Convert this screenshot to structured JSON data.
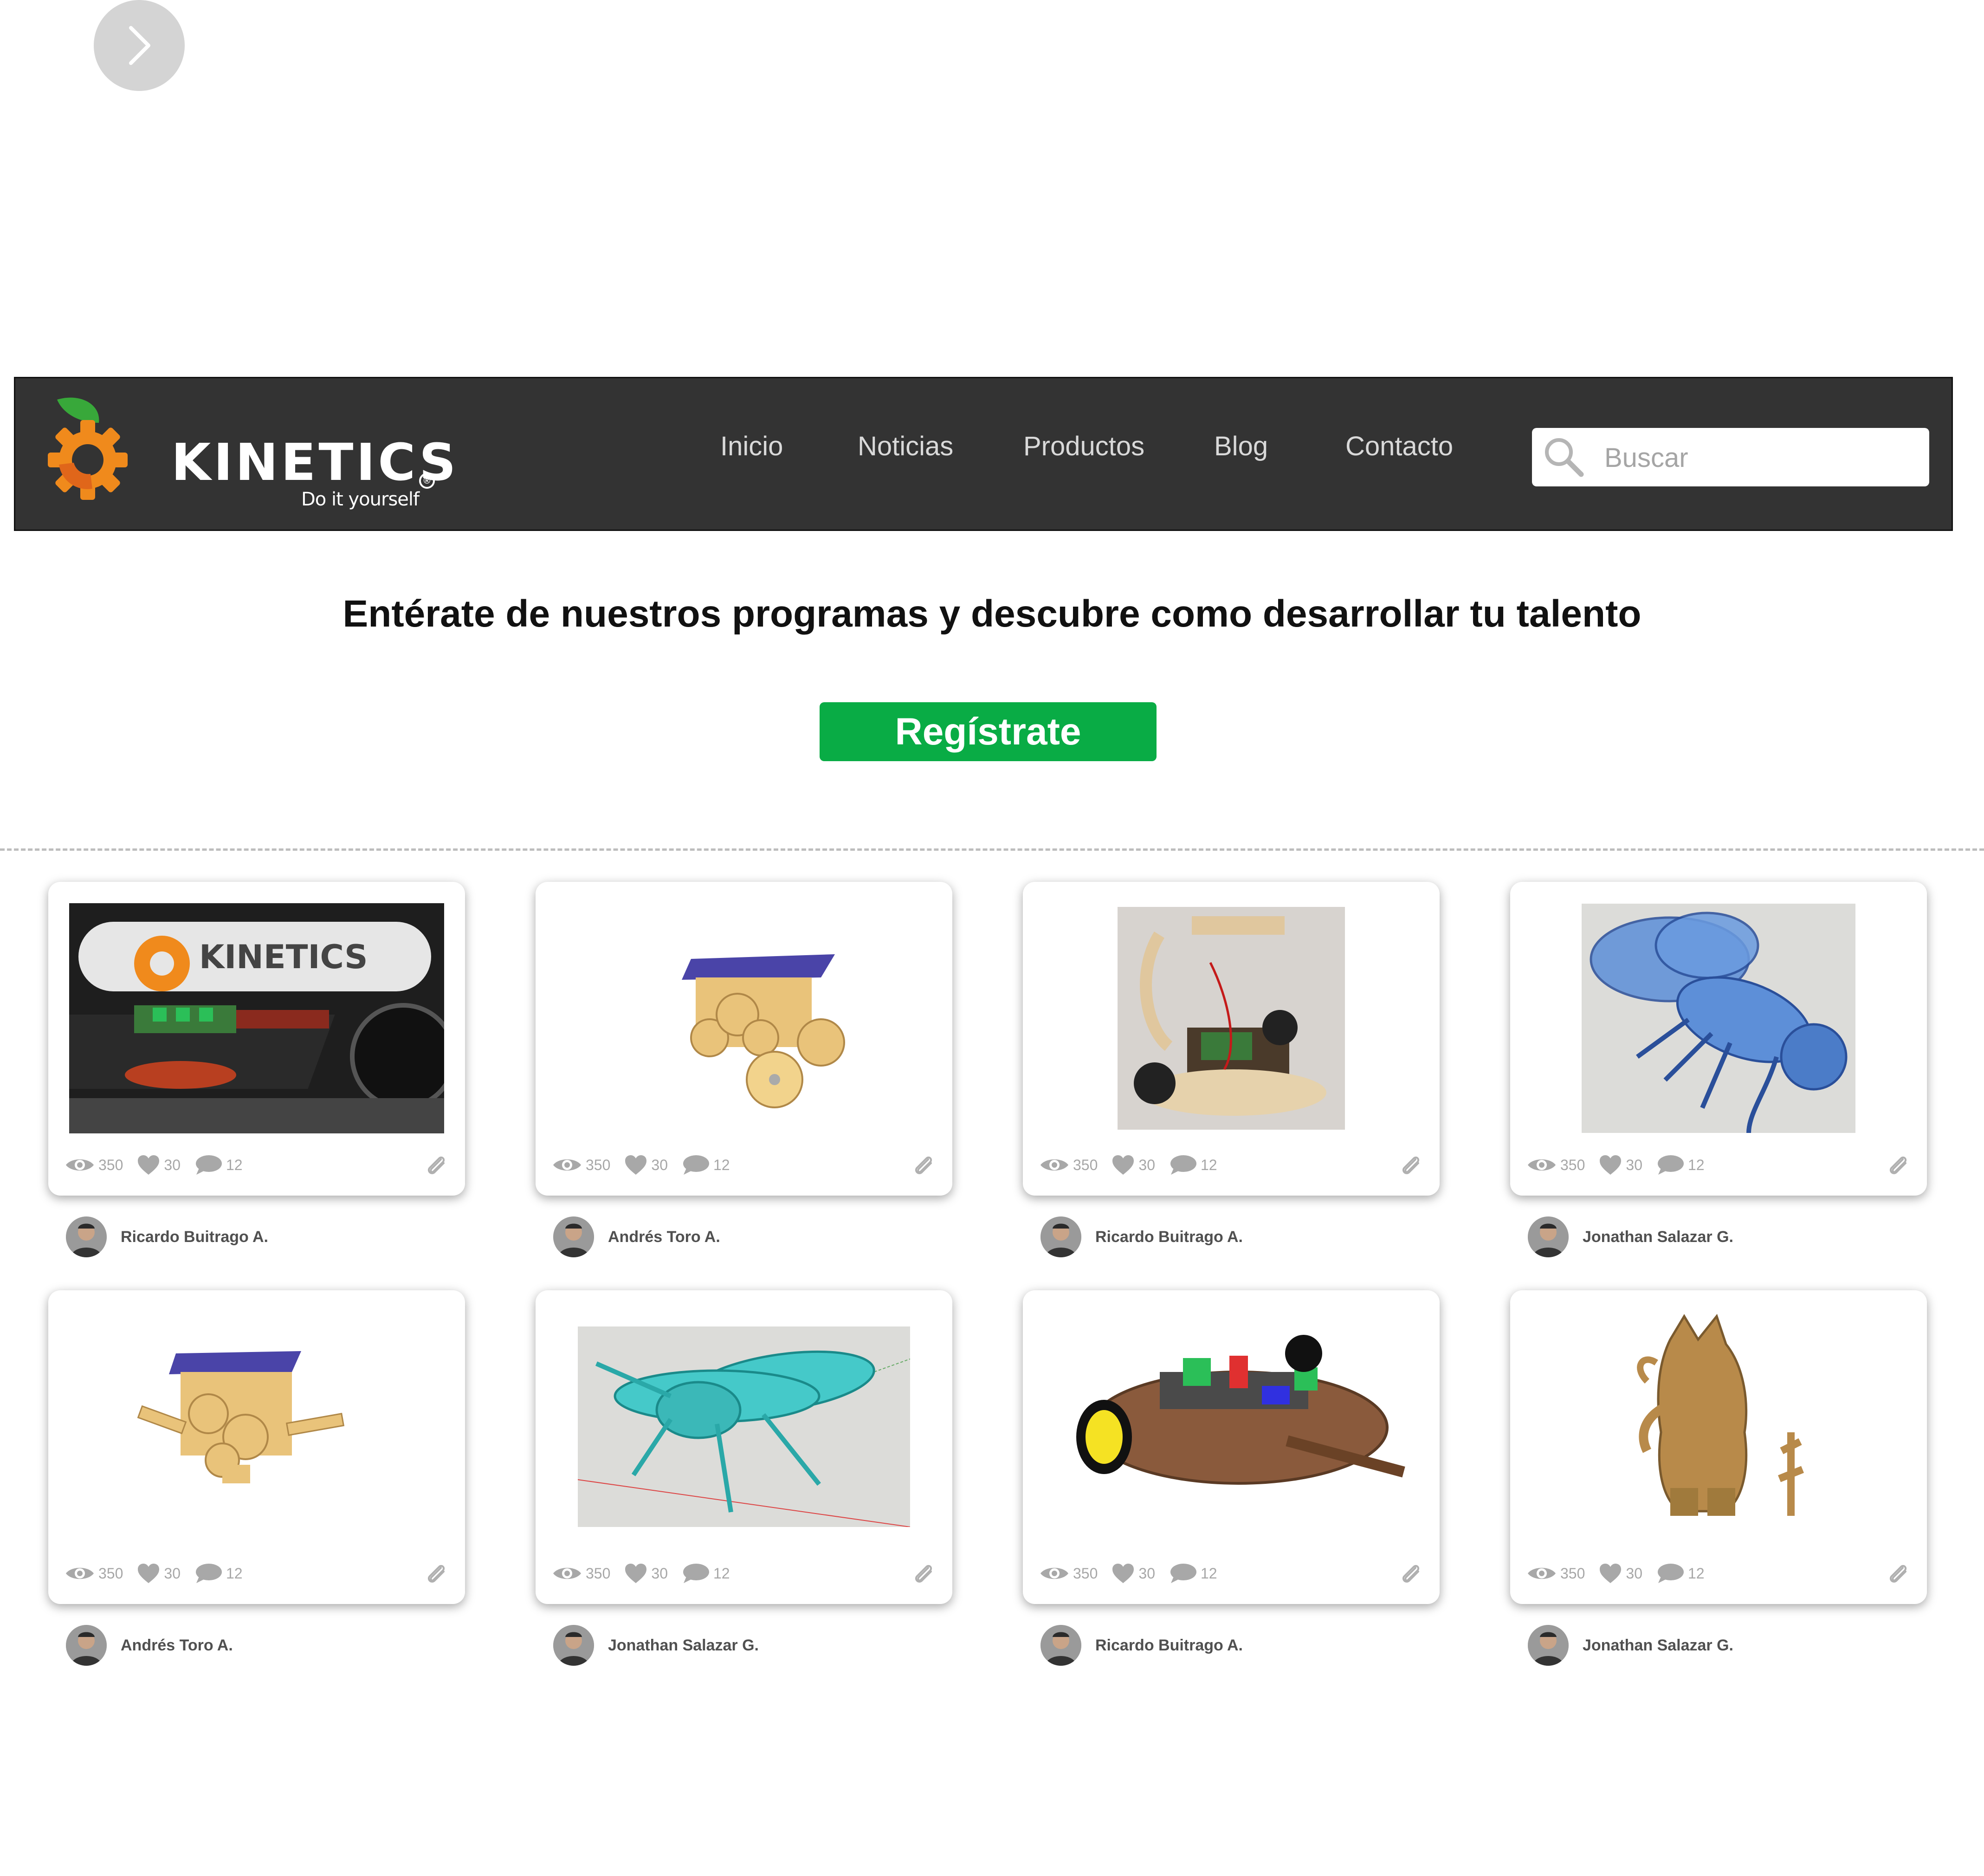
{
  "navbar": {
    "logo_text": "KINETICS",
    "logo_registered": "®",
    "logo_tagline": "Do it yourself",
    "items": [
      {
        "label": "Inicio"
      },
      {
        "label": "Noticias"
      },
      {
        "label": "Productos"
      },
      {
        "label": "Blog"
      },
      {
        "label": "Contacto"
      }
    ],
    "search_placeholder": "Buscar"
  },
  "hero": {
    "headline": "Entérate de nuestros programas y descubre como desarrollar tu talento",
    "register_label": "Regístrate"
  },
  "projects": [
    {
      "views": "350",
      "likes": "30",
      "comments": "12",
      "author": "Ricardo Buitrago A.",
      "image": "kinetics-board-photo"
    },
    {
      "views": "350",
      "likes": "30",
      "comments": "12",
      "author": "Andrés Toro A.",
      "image": "solar-gear-car"
    },
    {
      "views": "350",
      "likes": "30",
      "comments": "12",
      "author": "Ricardo Buitrago A.",
      "image": "wooden-robot-photo"
    },
    {
      "views": "350",
      "likes": "30",
      "comments": "12",
      "author": "Jonathan Salazar G.",
      "image": "blue-fly-model"
    },
    {
      "views": "350",
      "likes": "30",
      "comments": "12",
      "author": "Andrés Toro A.",
      "image": "solar-gear-walker"
    },
    {
      "views": "350",
      "likes": "30",
      "comments": "12",
      "author": "Jonathan Salazar G.",
      "image": "cyan-fly-model"
    },
    {
      "views": "350",
      "likes": "30",
      "comments": "12",
      "author": "Ricardo Buitrago A.",
      "image": "round-robot-platform"
    },
    {
      "views": "350",
      "likes": "30",
      "comments": "12",
      "author": "Jonathan Salazar G.",
      "image": "cardboard-creature"
    }
  ],
  "colors": {
    "navbar_bg": "#333333",
    "accent_green": "#09ac45",
    "logo_orange": "#f08a1c",
    "leaf_green": "#38a83a"
  }
}
